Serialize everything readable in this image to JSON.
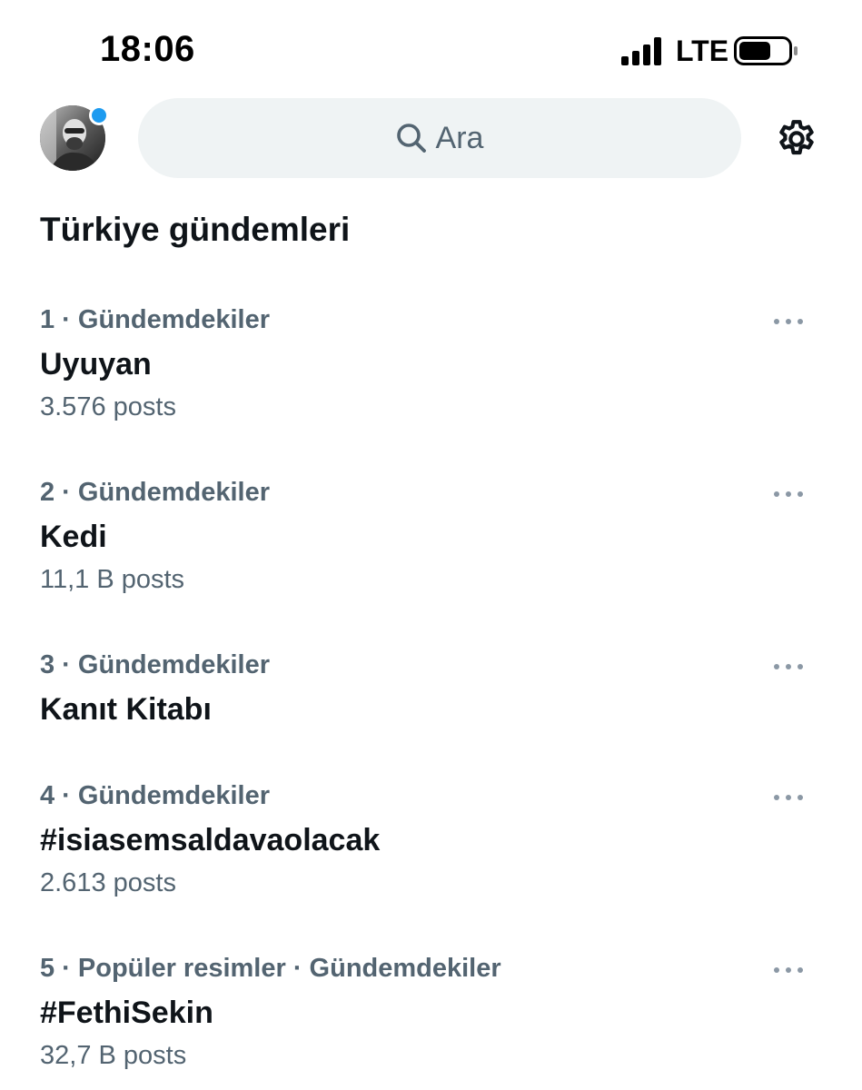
{
  "status_bar": {
    "time": "18:06",
    "network": "LTE"
  },
  "header": {
    "search_placeholder": "Ara"
  },
  "section": {
    "title": "Türkiye gündemleri"
  },
  "trends": [
    {
      "meta": "1 · Gündemdekiler",
      "name": "Uyuyan",
      "count": "3.576 posts"
    },
    {
      "meta": "2 · Gündemdekiler",
      "name": "Kedi",
      "count": "11,1 B posts"
    },
    {
      "meta": "3 · Gündemdekiler",
      "name": "Kanıt Kitabı",
      "count": ""
    },
    {
      "meta": "4 · Gündemdekiler",
      "name": "#isiasemsaldavaolacak",
      "count": "2.613 posts"
    },
    {
      "meta": "5 · Popüler resimler · Gündemdekiler",
      "name": "#FethiSekin",
      "count": "32,7 B posts"
    }
  ],
  "colors": {
    "accent": "#1d9bf0",
    "text_primary": "#0f1419",
    "text_secondary": "#536471",
    "search_bg": "#eff3f4"
  },
  "icons": {
    "search": "search-icon",
    "settings": "gear-icon",
    "more": "more-dots-icon",
    "signal": "cellular-signal-icon",
    "battery": "battery-icon"
  }
}
